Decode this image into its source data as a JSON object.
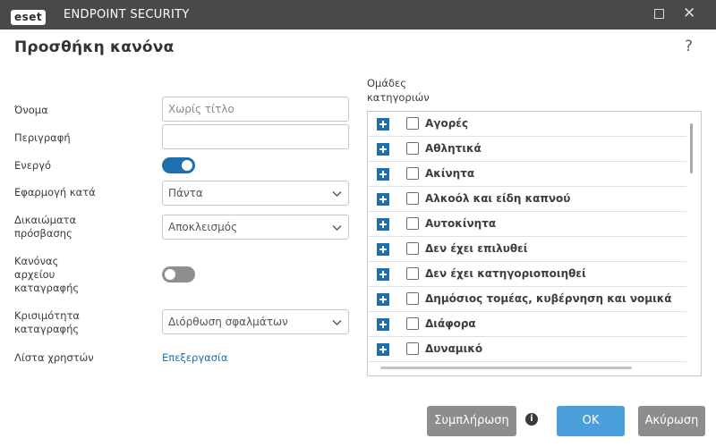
{
  "app": {
    "logo_text": "eset",
    "name": "ENDPOINT SECURITY"
  },
  "window": {
    "maximize_icon": "square-icon",
    "close_icon": "close-icon",
    "close_glyph": "✕"
  },
  "dialog": {
    "title": "Προσθήκη κανόνα",
    "help_glyph": "?"
  },
  "form": {
    "name_label": "Όνομα",
    "name_placeholder": "Χωρίς τίτλο",
    "name_value": "",
    "description_label": "Περιγραφή",
    "description_value": "",
    "enabled_label": "Ενεργό",
    "enabled": true,
    "apply_by_label": "Εφαρμογή κατά",
    "apply_by_value": "Πάντα",
    "access_rights_label_line1": "Δικαιώματα",
    "access_rights_label_line2": "πρόσβασης",
    "access_rights_value": "Αποκλεισμός",
    "log_rule_label_line1": "Κανόνας",
    "log_rule_label_line2": "αρχείου",
    "log_rule_label_line3": "καταγραφής",
    "log_rule_enabled": false,
    "log_severity_label_line1": "Κρισιμότητα",
    "log_severity_label_line2": "καταγραφής",
    "log_severity_value": "Διόρθωση σφαλμάτων",
    "user_list_label": "Λίστα χρηστών",
    "user_list_link": "Επεξεργασία"
  },
  "categories": {
    "caption_line1": "Ομάδες",
    "caption_line2": "κατηγοριών",
    "items": [
      {
        "label": "Αγορές",
        "checked": false
      },
      {
        "label": "Αθλητικά",
        "checked": false
      },
      {
        "label": "Ακίνητα",
        "checked": false
      },
      {
        "label": "Αλκοόλ και είδη καπνού",
        "checked": false
      },
      {
        "label": "Αυτοκίνητα",
        "checked": false
      },
      {
        "label": "Δεν έχει επιλυθεί",
        "checked": false
      },
      {
        "label": "Δεν έχει κατηγοριοποιηθεί",
        "checked": false
      },
      {
        "label": "Δημόσιος τομέας, κυβέρνηση και νομικά",
        "checked": false
      },
      {
        "label": "Διάφορα",
        "checked": false
      },
      {
        "label": "Δυναμικό",
        "checked": false
      }
    ]
  },
  "buttons": {
    "populate_label": "Συμπλήρωση",
    "info_glyph": "i",
    "ok_label": "OK",
    "cancel_label": "Ακύρωση"
  },
  "colors": {
    "titlebar": "#494949",
    "accent": "#1f6fad",
    "ok_button": "#4a9fdb",
    "grey_button": "#8d8d8d"
  }
}
